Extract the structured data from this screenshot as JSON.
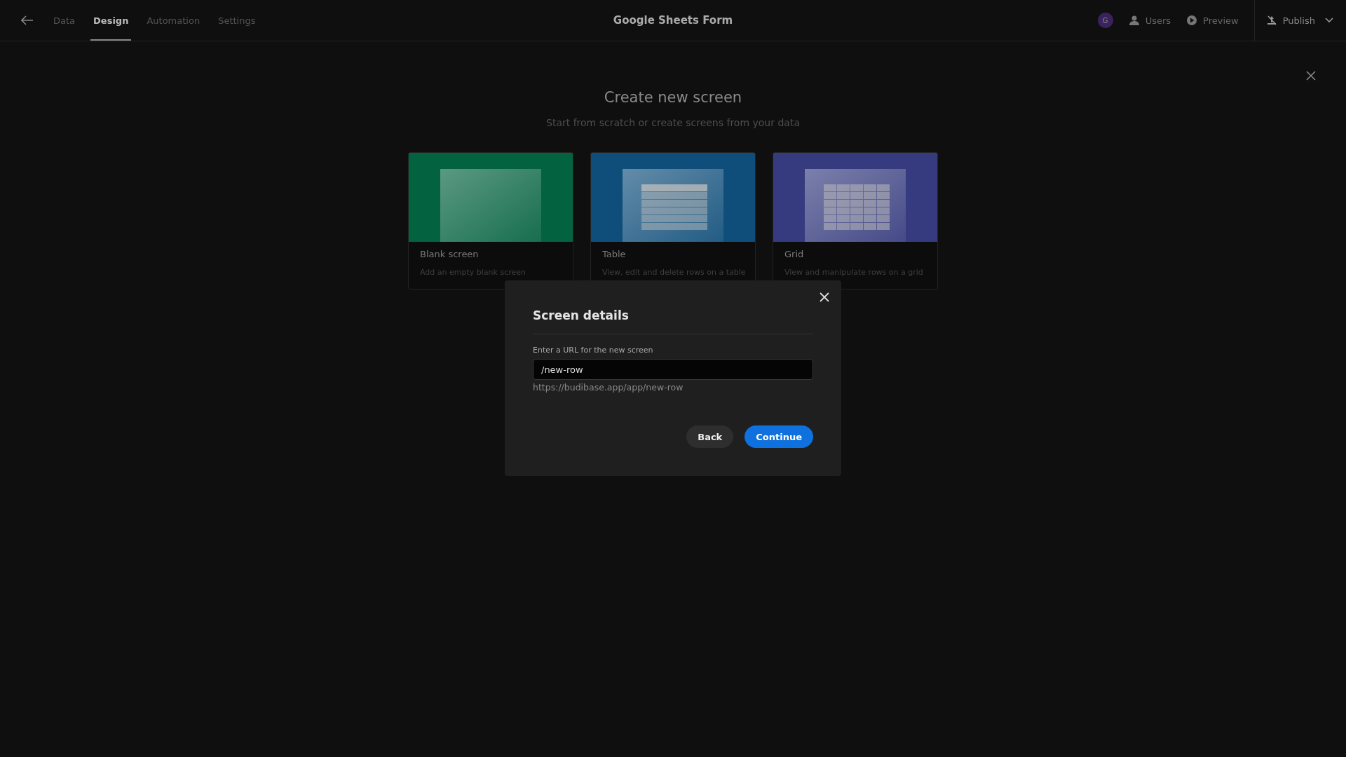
{
  "top_bar": {
    "tabs": [
      {
        "label": "Data",
        "selected": false
      },
      {
        "label": "Design",
        "selected": true
      },
      {
        "label": "Automation",
        "selected": false
      },
      {
        "label": "Settings",
        "selected": false
      }
    ],
    "title": "Google Sheets Form",
    "avatar": "G",
    "actions": [
      {
        "kind": "users",
        "label": "Users"
      },
      {
        "kind": "preview",
        "label": "Preview"
      }
    ],
    "publish": "Publish"
  },
  "page": {
    "title": "Create new screen",
    "subtitle": "Start from scratch or create screens from your data",
    "cards": [
      {
        "kind": "blank",
        "title": "Blank screen",
        "description": "Add an empty blank screen",
        "color": "#03623f"
      },
      {
        "kind": "table",
        "title": "Table",
        "description": "View, edit and delete rows on a table",
        "color": "#0f4e7a"
      },
      {
        "kind": "grid",
        "title": "Grid",
        "description": "View and manipulate rows on a grid",
        "color": "#353b7e"
      }
    ]
  },
  "modal": {
    "title": "Screen details",
    "field_label": "Enter a URL for the new screen",
    "url_value": "/new-row",
    "url_preview": "https://budibase.app/app/new-row",
    "buttons": [
      {
        "kind": "secondary",
        "label": "Back"
      },
      {
        "kind": "primary",
        "label": "Continue"
      }
    ]
  }
}
